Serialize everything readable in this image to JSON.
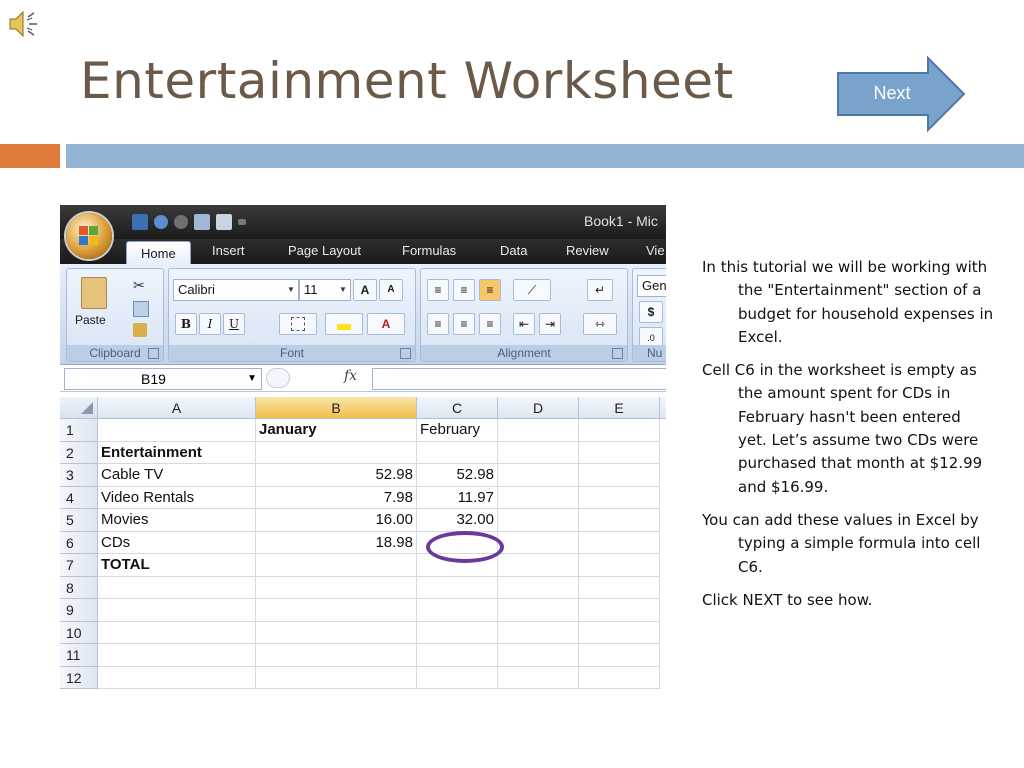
{
  "slide": {
    "title": "Entertainment Worksheet",
    "next_label": "Next",
    "speaker_icon": "speaker-icon",
    "colors": {
      "title": "#6b5a4a",
      "bar_orange": "#e07b3c",
      "bar_blue": "#93b5d3",
      "next_fill": "#7aa3cc",
      "highlight": "#6a3a9a"
    }
  },
  "excel": {
    "title": "Book1 - Mic",
    "tabs": [
      "Home",
      "Insert",
      "Page Layout",
      "Formulas",
      "Data",
      "Review",
      "Vie"
    ],
    "ribbon": {
      "clipboard": {
        "paste": "Paste",
        "label": "Clipboard"
      },
      "font": {
        "name": "Calibri",
        "size": "11",
        "grow": "A",
        "shrink": "A",
        "bold": "B",
        "italic": "I",
        "underline": "U",
        "color_letter": "A",
        "label": "Font"
      },
      "alignment": {
        "label": "Alignment"
      },
      "number": {
        "format": "Gen",
        "currency": "$",
        "label": "Nu"
      }
    },
    "name_box": "B19",
    "fx": "fx",
    "columns": [
      "A",
      "B",
      "C",
      "D",
      "E"
    ],
    "rows": [
      {
        "num": "1",
        "a": "",
        "b": "January",
        "c": "February",
        "bold_b": true
      },
      {
        "num": "2",
        "a": "Entertainment",
        "b": "",
        "c": "",
        "bold_a": true
      },
      {
        "num": "3",
        "a": "Cable TV",
        "b": "52.98",
        "c": "52.98"
      },
      {
        "num": "4",
        "a": "Video Rentals",
        "b": "7.98",
        "c": "11.97"
      },
      {
        "num": "5",
        "a": "Movies",
        "b": "16.00",
        "c": "32.00"
      },
      {
        "num": "6",
        "a": "CDs",
        "b": "18.98",
        "c": ""
      },
      {
        "num": "7",
        "a": "TOTAL",
        "b": "",
        "c": "",
        "bold_a": true
      },
      {
        "num": "8",
        "a": "",
        "b": "",
        "c": ""
      },
      {
        "num": "9",
        "a": "",
        "b": "",
        "c": ""
      },
      {
        "num": "10",
        "a": "",
        "b": "",
        "c": ""
      },
      {
        "num": "11",
        "a": "",
        "b": "",
        "c": ""
      },
      {
        "num": "12",
        "a": "",
        "b": "",
        "c": ""
      }
    ]
  },
  "notes": {
    "p1": "In this tutorial we will be working with the \"Entertainment\" section of a budget for household expenses in Excel.",
    "p2": "Cell C6 in the worksheet is empty as the amount spent for CDs in February hasn't been entered yet. Let’s assume two CDs were purchased that month at $12.99 and $16.99.",
    "p3": "You can add these values in Excel by typing a simple formula into cell C6.",
    "p4": "Click NEXT to see how."
  }
}
